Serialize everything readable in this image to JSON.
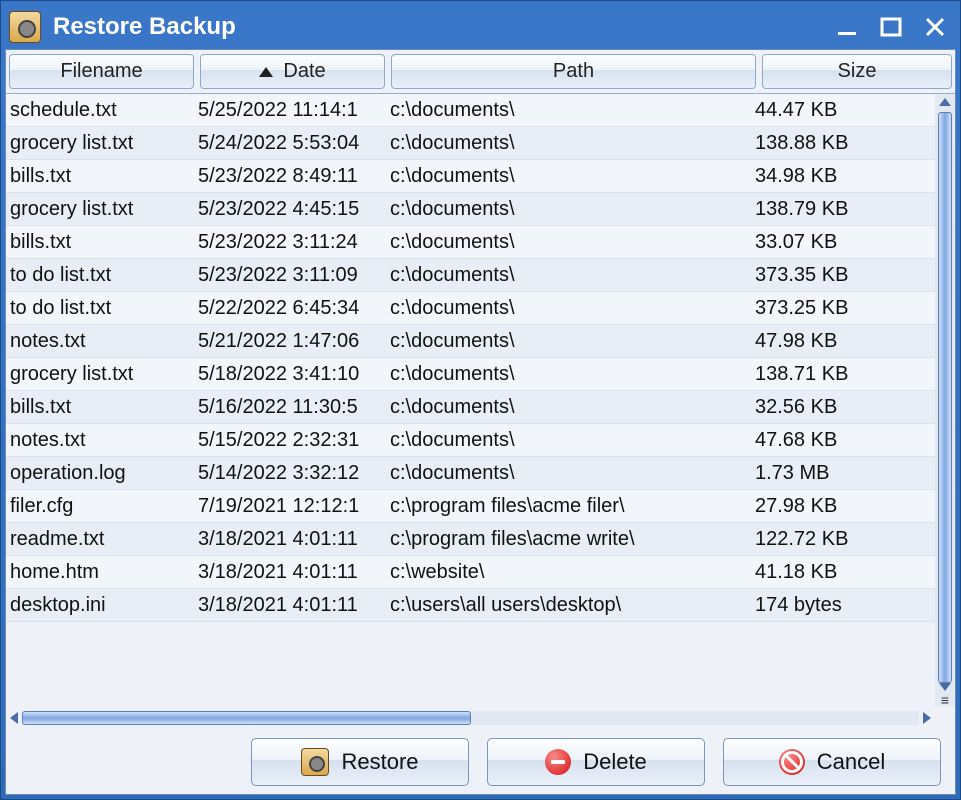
{
  "window": {
    "title": "Restore Backup"
  },
  "columns": {
    "filename": "Filename",
    "date": "Date",
    "path": "Path",
    "size": "Size",
    "sort_column": "date",
    "sort_direction": "asc"
  },
  "rows": [
    {
      "filename": "schedule.txt",
      "date": "5/25/2022 11:14:1",
      "path": "c:\\documents\\",
      "size": "44.47 KB"
    },
    {
      "filename": "grocery list.txt",
      "date": "5/24/2022 5:53:04",
      "path": "c:\\documents\\",
      "size": "138.88 KB"
    },
    {
      "filename": "bills.txt",
      "date": "5/23/2022 8:49:11",
      "path": "c:\\documents\\",
      "size": "34.98 KB"
    },
    {
      "filename": "grocery list.txt",
      "date": "5/23/2022 4:45:15",
      "path": "c:\\documents\\",
      "size": "138.79 KB"
    },
    {
      "filename": "bills.txt",
      "date": "5/23/2022 3:11:24",
      "path": "c:\\documents\\",
      "size": "33.07 KB"
    },
    {
      "filename": "to do list.txt",
      "date": "5/23/2022 3:11:09",
      "path": "c:\\documents\\",
      "size": "373.35 KB"
    },
    {
      "filename": "to do list.txt",
      "date": "5/22/2022 6:45:34",
      "path": "c:\\documents\\",
      "size": "373.25 KB"
    },
    {
      "filename": "notes.txt",
      "date": "5/21/2022 1:47:06",
      "path": "c:\\documents\\",
      "size": "47.98 KB"
    },
    {
      "filename": "grocery list.txt",
      "date": "5/18/2022 3:41:10",
      "path": "c:\\documents\\",
      "size": "138.71 KB"
    },
    {
      "filename": "bills.txt",
      "date": "5/16/2022 11:30:5",
      "path": "c:\\documents\\",
      "size": "32.56 KB"
    },
    {
      "filename": "notes.txt",
      "date": "5/15/2022 2:32:31",
      "path": "c:\\documents\\",
      "size": "47.68 KB"
    },
    {
      "filename": "operation.log",
      "date": "5/14/2022 3:32:12",
      "path": "c:\\documents\\",
      "size": "1.73 MB"
    },
    {
      "filename": "filer.cfg",
      "date": "7/19/2021 12:12:1",
      "path": "c:\\program files\\acme filer\\",
      "size": "27.98 KB"
    },
    {
      "filename": "readme.txt",
      "date": "3/18/2021 4:01:11",
      "path": "c:\\program files\\acme write\\",
      "size": "122.72 KB"
    },
    {
      "filename": "home.htm",
      "date": "3/18/2021 4:01:11",
      "path": "c:\\website\\",
      "size": "41.18 KB"
    },
    {
      "filename": "desktop.ini",
      "date": "3/18/2021 4:01:11",
      "path": "c:\\users\\all users\\desktop\\",
      "size": "174 bytes"
    }
  ],
  "buttons": {
    "restore": "Restore",
    "delete": "Delete",
    "cancel": "Cancel"
  }
}
